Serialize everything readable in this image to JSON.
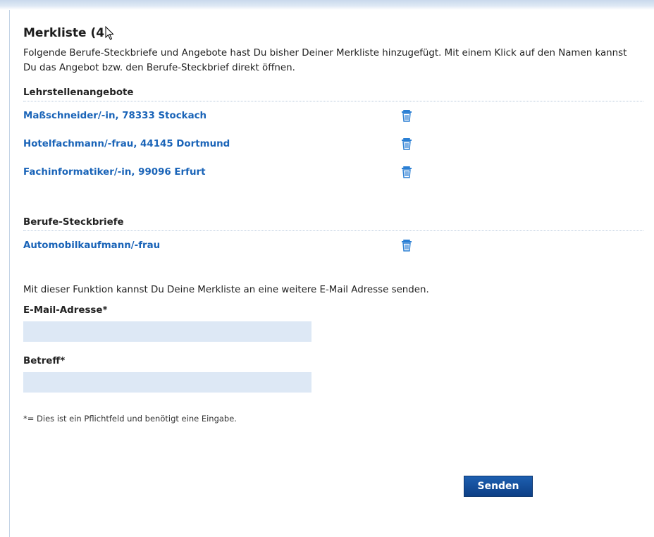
{
  "page": {
    "title": "Merkliste (4",
    "intro": "Folgende Berufe-Steckbriefe und Angebote hast Du bisher Deiner Merkliste hinzugefügt. Mit einem Klick auf den Namen kannst Du das Angebot bzw. den Berufe-Steckbrief direkt öffnen."
  },
  "colors": {
    "link": "#1a64b8",
    "input_bg": "#dde8f5",
    "button_bg": "#12488f",
    "divider": "#b7c7dc"
  },
  "lehrstellen": {
    "heading": "Lehrstellenangebote",
    "items": [
      {
        "label": "Maßschneider/-in, 78333 Stockach",
        "icon": "trash-icon"
      },
      {
        "label": "Hotelfachmann/-frau, 44145 Dortmund",
        "icon": "trash-icon"
      },
      {
        "label": "Fachinformatiker/-in, 99096 Erfurt",
        "icon": "trash-icon"
      }
    ]
  },
  "steckbriefe": {
    "heading": "Berufe-Steckbriefe",
    "items": [
      {
        "label": "Automobilkaufmann/-frau",
        "icon": "trash-icon"
      }
    ]
  },
  "send_form": {
    "info": "Mit dieser Funktion kannst Du Deine Merkliste an eine weitere E-Mail Adresse senden.",
    "email_label": "E-Mail-Adresse*",
    "email_value": "",
    "subject_label": "Betreff*",
    "subject_value": "",
    "required_note": "*= Dies ist ein Pflichtfeld und benötigt eine Eingabe.",
    "submit_label": "Senden"
  }
}
